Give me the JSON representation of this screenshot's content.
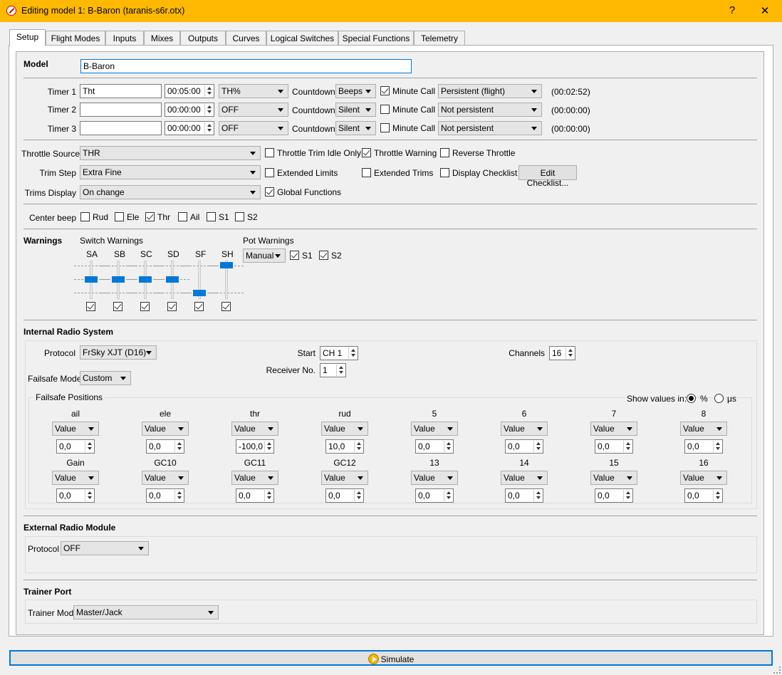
{
  "window": {
    "title": "Editing model 1: B-Baron   (taranis-s6r.otx)",
    "help": "?",
    "close": "✕"
  },
  "tabs": [
    "Setup",
    "Flight Modes",
    "Inputs",
    "Mixes",
    "Outputs",
    "Curves",
    "Logical Switches",
    "Special Functions",
    "Telemetry"
  ],
  "model": {
    "label": "Model",
    "name": "B-Baron"
  },
  "timers": [
    {
      "label": "Timer 1",
      "name": "Tht",
      "time": "00:05:00",
      "mode": "TH%",
      "countdown_label": "Countdown",
      "countdown": "Beeps",
      "minute_call": true,
      "minute_call_label": "Minute Call",
      "persist": "Persistent (flight)",
      "value": "(00:02:52)"
    },
    {
      "label": "Timer 2",
      "name": "",
      "time": "00:00:00",
      "mode": "OFF",
      "countdown_label": "Countdown",
      "countdown": "Silent",
      "minute_call": false,
      "minute_call_label": "Minute Call",
      "persist": "Not persistent",
      "value": "(00:00:00)"
    },
    {
      "label": "Timer 3",
      "name": "",
      "time": "00:00:00",
      "mode": "OFF",
      "countdown_label": "Countdown",
      "countdown": "Silent",
      "minute_call": false,
      "minute_call_label": "Minute Call",
      "persist": "Not persistent",
      "value": "(00:00:00)"
    }
  ],
  "throttle": {
    "source_label": "Throttle Source",
    "source": "THR",
    "trim_idle_only": "Throttle Trim Idle Only",
    "warning": "Throttle Warning",
    "reverse": "Reverse Throttle",
    "trim_step_label": "Trim Step",
    "trim_step": "Extra Fine",
    "extended_limits": "Extended Limits",
    "extended_trims": "Extended Trims",
    "display_checklist": "Display Checklist",
    "edit_checklist": "Edit Checklist...",
    "trims_display_label": "Trims Display",
    "trims_display": "On change",
    "global_functions": "Global Functions"
  },
  "center_beep": {
    "label": "Center beep",
    "items": [
      {
        "name": "Rud",
        "on": false
      },
      {
        "name": "Ele",
        "on": false
      },
      {
        "name": "Thr",
        "on": true
      },
      {
        "name": "Ail",
        "on": false
      },
      {
        "name": "S1",
        "on": false
      },
      {
        "name": "S2",
        "on": false
      }
    ]
  },
  "warnings": {
    "label": "Warnings",
    "switch_label": "Switch Warnings",
    "pot_label": "Pot Warnings",
    "pot_mode": "Manual",
    "switches": [
      {
        "name": "SA",
        "pos": "mid"
      },
      {
        "name": "SB",
        "pos": "mid"
      },
      {
        "name": "SC",
        "pos": "mid"
      },
      {
        "name": "SD",
        "pos": "mid"
      },
      {
        "name": "SF",
        "pos": "down"
      },
      {
        "name": "SH",
        "pos": "up"
      }
    ],
    "pots": [
      "S1",
      "S2"
    ]
  },
  "internal": {
    "label": "Internal Radio System",
    "protocol_label": "Protocol",
    "protocol": "FrSky XJT (D16)",
    "start_label": "Start",
    "start": "CH 1",
    "channels_label": "Channels",
    "channels": "16",
    "receiver_label": "Receiver No.",
    "receiver": "1",
    "failsafe_label": "Failsafe Mode",
    "failsafe": "Custom",
    "positions_label": "Failsafe Positions",
    "show_label": "Show values in:",
    "pct": "%",
    "us": "μs",
    "channels_list": [
      {
        "name": "ail",
        "mode": "Value",
        "val": "0,0"
      },
      {
        "name": "ele",
        "mode": "Value",
        "val": "0,0"
      },
      {
        "name": "thr",
        "mode": "Value",
        "val": "-100,0"
      },
      {
        "name": "rud",
        "mode": "Value",
        "val": "10,0"
      },
      {
        "name": "5",
        "mode": "Value",
        "val": "0,0"
      },
      {
        "name": "6",
        "mode": "Value",
        "val": "0,0"
      },
      {
        "name": "7",
        "mode": "Value",
        "val": "0,0"
      },
      {
        "name": "8",
        "mode": "Value",
        "val": "0,0"
      },
      {
        "name": "Gain",
        "mode": "Value",
        "val": "0,0"
      },
      {
        "name": "GC10",
        "mode": "Value",
        "val": "0,0"
      },
      {
        "name": "GC11",
        "mode": "Value",
        "val": "0,0"
      },
      {
        "name": "GC12",
        "mode": "Value",
        "val": "0,0"
      },
      {
        "name": "13",
        "mode": "Value",
        "val": "0,0"
      },
      {
        "name": "14",
        "mode": "Value",
        "val": "0,0"
      },
      {
        "name": "15",
        "mode": "Value",
        "val": "0,0"
      },
      {
        "name": "16",
        "mode": "Value",
        "val": "0,0"
      }
    ]
  },
  "external": {
    "label": "External Radio Module",
    "protocol_label": "Protocol",
    "protocol": "OFF"
  },
  "trainer": {
    "label": "Trainer Port",
    "mode_label": "Trainer Mode",
    "mode": "Master/Jack"
  },
  "simulate": "Simulate"
}
